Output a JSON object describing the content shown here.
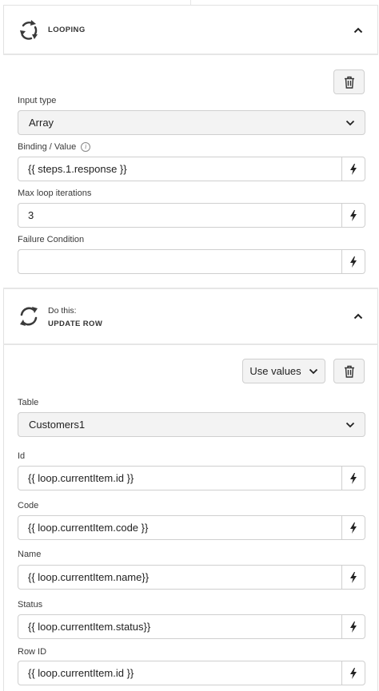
{
  "looping": {
    "title": "LOOPING",
    "fields": {
      "input_type_label": "Input type",
      "input_type_value": "Array",
      "binding_label": "Binding / Value",
      "binding_value": "{{ steps.1.response }}",
      "max_label": "Max loop iterations",
      "max_value": "3",
      "failure_label": "Failure Condition",
      "failure_value": ""
    }
  },
  "update_row": {
    "subtitle": "Do this:",
    "title": "UPDATE ROW",
    "use_values_label": "Use values",
    "table_label": "Table",
    "table_value": "Customers1",
    "fields": [
      {
        "label": "Id",
        "value": "{{ loop.currentItem.id }}"
      },
      {
        "label": "Code",
        "value": "{{ loop.currentItem.code }}"
      },
      {
        "label": "Name",
        "value": "{{ loop.currentItem.name}}"
      },
      {
        "label": "Status",
        "value": "{{ loop.currentItem.status}}"
      },
      {
        "label": "Row ID",
        "value": "{{ loop.currentItem.id }}"
      }
    ]
  },
  "colors": {
    "border": "#cfcfcf",
    "select_bg": "#f3f3f3",
    "icon": "#3a3a3a"
  },
  "icons": [
    "loop-icon",
    "refresh-icon",
    "chevron-up-icon",
    "chevron-down-icon",
    "trash-icon",
    "bolt-icon",
    "info-icon"
  ]
}
